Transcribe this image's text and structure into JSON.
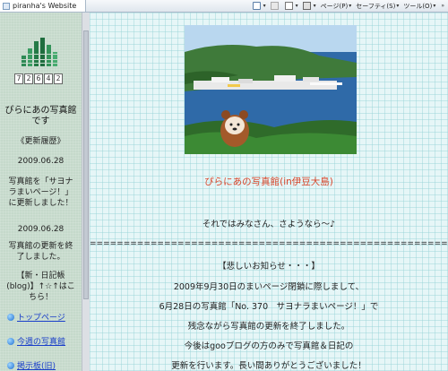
{
  "browser": {
    "tab_title": "piranha's Website",
    "commands": {
      "page_label": "ページ(P)",
      "safety_label": "セーフティ(S)",
      "tools_label": "ツール(O)"
    }
  },
  "sidebar": {
    "counter_digits": [
      "7",
      "2",
      "6",
      "4",
      "2"
    ],
    "site_title": "ぴらにあの写真館です",
    "history_label": "《更新履歴》",
    "date1": "2009.06.28",
    "news1": "写真館を「サヨナラまいページ！」に更新しました！",
    "date2": "2009.06.28",
    "news2": "写真館の更新を終了しました。",
    "blog": "【新・日記帳(blog)】↑☆↑はこちら！",
    "links": [
      {
        "label": "トップページ"
      },
      {
        "label": "今週の写真館"
      },
      {
        "label": "掲示板(旧)"
      }
    ]
  },
  "main": {
    "photo_alt": "photo",
    "title": "ぴらにあの写真館(in伊豆大島)",
    "farewell": "それではみなさん、さようなら～♪",
    "separator": "================================================================",
    "notice_head": "【悲しいお知らせ・・・】",
    "lines": [
      "2009年9月30日のまいページ閉鎖に際しまして、",
      "6月28日の写真館「No. 370　サヨナラまいページ！」で",
      "残念ながら写真館の更新を終了しました。",
      "今後はgooブログの方のみで写真館＆日記の",
      "更新を行います。長い間ありがとうございました！"
    ]
  },
  "colors": {
    "title_accent": "#d8452a",
    "link": "#1a3fc9",
    "sidebar_bg": "#c5d9cb",
    "main_bg": "#e6f6f7"
  }
}
